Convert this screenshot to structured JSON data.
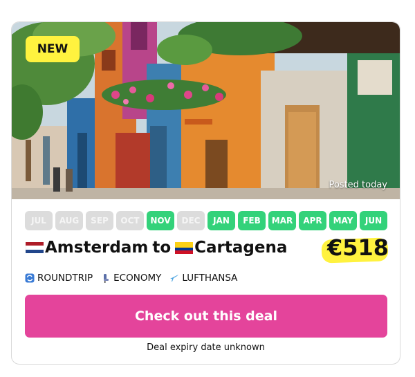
{
  "badge": "NEW",
  "posted": "Posted today",
  "months": [
    {
      "label": "JUL",
      "active": false
    },
    {
      "label": "AUG",
      "active": false
    },
    {
      "label": "SEP",
      "active": false
    },
    {
      "label": "OCT",
      "active": false
    },
    {
      "label": "NOV",
      "active": true
    },
    {
      "label": "DEC",
      "active": false
    },
    {
      "label": "JAN",
      "active": true
    },
    {
      "label": "FEB",
      "active": true
    },
    {
      "label": "MAR",
      "active": true
    },
    {
      "label": "APR",
      "active": true
    },
    {
      "label": "MAY",
      "active": true
    },
    {
      "label": "JUN",
      "active": true
    }
  ],
  "route": {
    "from": "Amsterdam",
    "connector": "to",
    "to": "Cartagena"
  },
  "price": "€518",
  "tags": {
    "trip": "ROUNDTRIP",
    "cabin": "ECONOMY",
    "airline": "LUFTHANSA"
  },
  "cta": "Check out this deal",
  "expiry": "Deal expiry date unknown",
  "colors": {
    "active_month": "#33d27a",
    "inactive_month": "#dcdcdc",
    "cta": "#e4449b",
    "highlight": "#fff23f"
  },
  "icons": {
    "trip": "roundtrip-icon",
    "cabin": "seat-icon",
    "airline": "plane-icon"
  }
}
